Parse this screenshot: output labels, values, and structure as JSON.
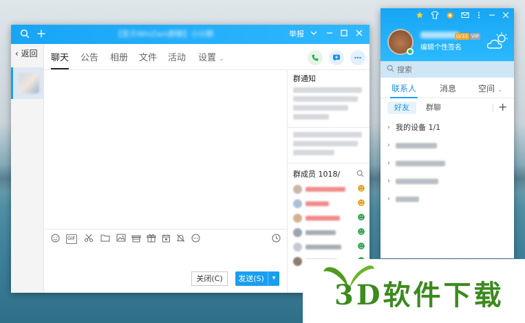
{
  "chat_window": {
    "title": "【官方WinZam群聊】小分群",
    "report_label": "举报",
    "back_label": "返回",
    "tabs": [
      "聊天",
      "公告",
      "相册",
      "文件",
      "活动",
      "设置"
    ],
    "toolbar": {
      "gif_label": "GIF"
    },
    "close_button": "关闭(C)",
    "send_button": "发送(S)",
    "right_pane": {
      "notice_title": "群通知",
      "members_label": "群成员 1018/"
    }
  },
  "main_panel": {
    "level_badge": "LV33",
    "vip_badge": "VIP",
    "signature": "编辑个性签名",
    "search_placeholder": "搜索",
    "tabs": [
      "联系人",
      "消息",
      "空间"
    ],
    "subtabs": [
      "好友",
      "群聊"
    ],
    "contact_groups": [
      {
        "label": "我的设备",
        "count": "1/1"
      }
    ]
  },
  "watermark": {
    "text": "3D软件下载"
  },
  "colors": {
    "accent": "#1a9ef2",
    "header_gradient_start": "#18a5f5",
    "header_gradient_end": "#2fb8ff",
    "online": "#26c24f",
    "watermark_green": "#3d8a1f"
  },
  "icons": {
    "chat_titlebar": [
      "search-icon",
      "plus-icon",
      "chevron-down-icon",
      "minimize-icon",
      "maximize-icon",
      "close-icon"
    ],
    "chat_actions": [
      "phone-icon",
      "message-add-icon",
      "more-icon"
    ],
    "toolbar": [
      "emoji-icon",
      "gif-icon",
      "scissors-icon",
      "folder-icon",
      "image-icon",
      "gift-box-icon",
      "gift-icon",
      "calendar-icon",
      "bell-off-icon",
      "more-circle-icon",
      "history-clock-icon"
    ],
    "main_titlebar": [
      "star-icon",
      "shirt-icon",
      "medal-icon",
      "mail-icon",
      "menu-dots-icon",
      "minimize-icon",
      "close-icon"
    ]
  }
}
